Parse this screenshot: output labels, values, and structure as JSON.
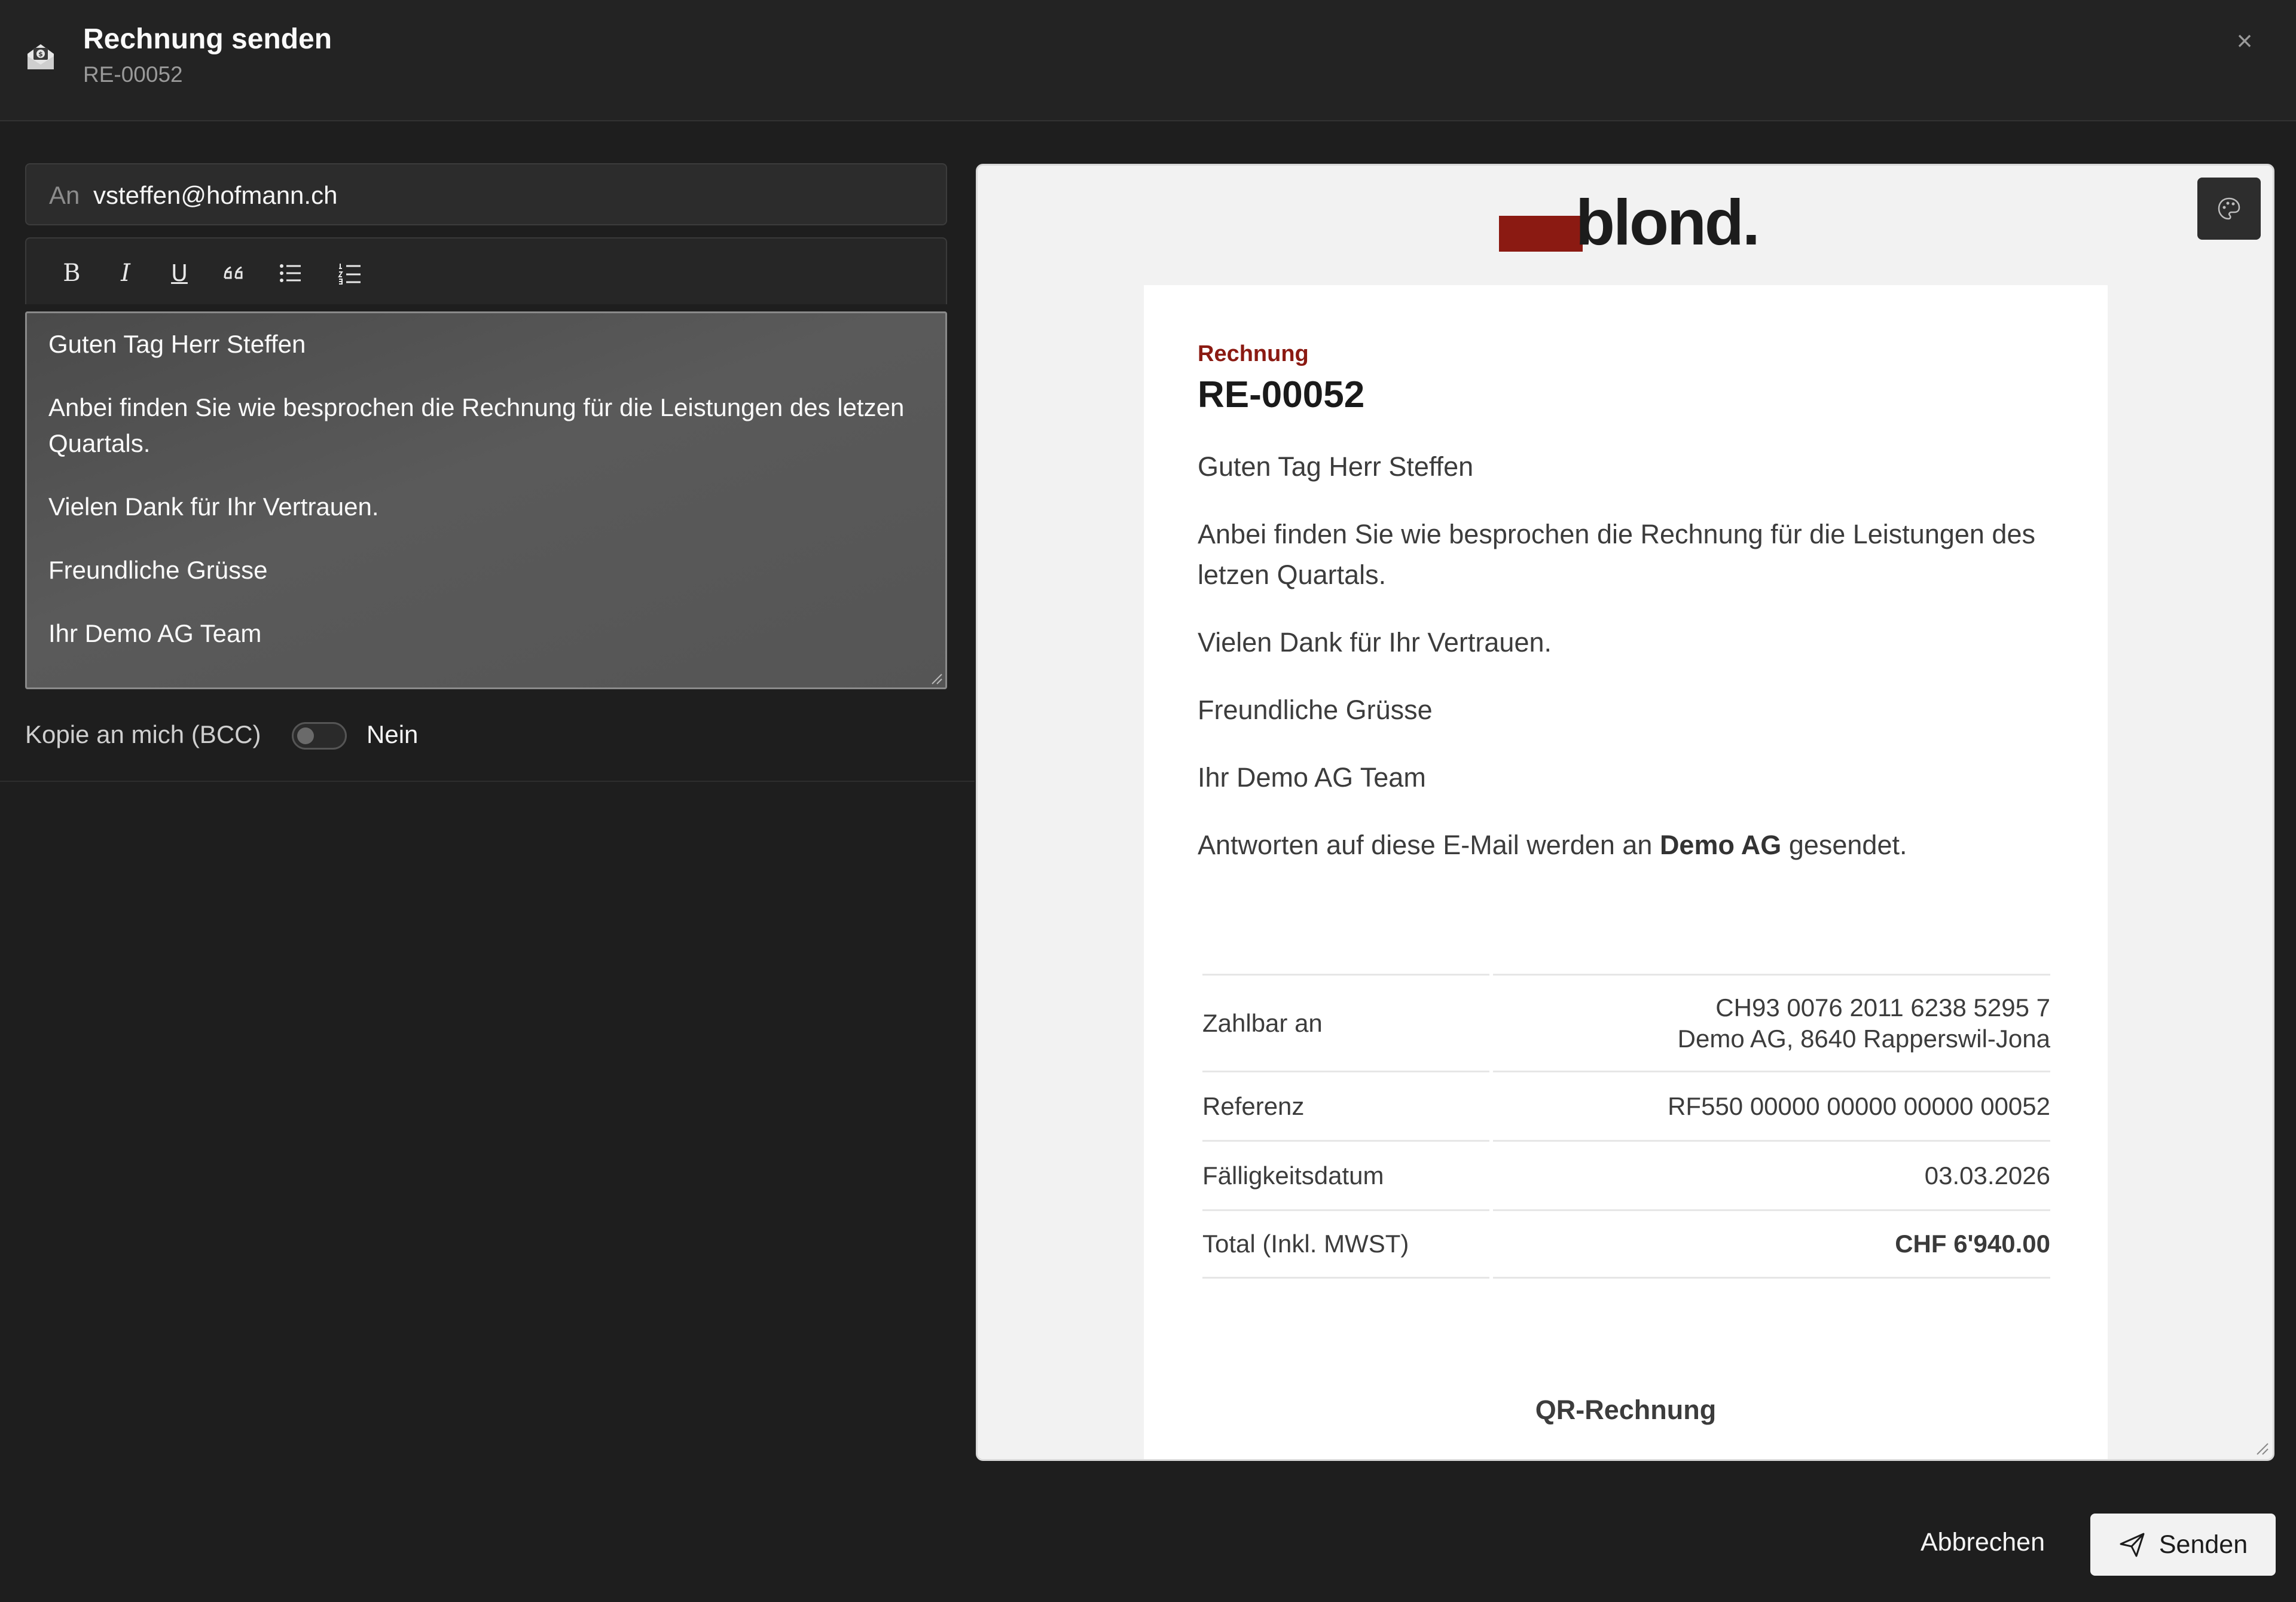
{
  "header": {
    "title": "Rechnung senden",
    "subtitle": "RE-00052",
    "close_glyph": "×",
    "icon": "envelope-money-icon"
  },
  "compose": {
    "to_label": "An",
    "to_value": "vsteffen@hofmann.ch",
    "toolbar": [
      "bold-icon",
      "italic-icon",
      "underline-icon",
      "quote-icon",
      "bullet-list-icon",
      "numbered-list-icon"
    ],
    "toolbar_glyphs": {
      "bold": "B",
      "italic": "I",
      "underline": "U"
    },
    "body": [
      "Guten Tag Herr Steffen",
      "Anbei finden Sie wie besprochen die Rechnung für die Leistungen des letzen Quartals.",
      "Vielen Dank für Ihr Vertrauen.",
      "Freundliche Grüsse",
      "Ihr Demo AG Team"
    ],
    "bcc_label": "Kopie an mich (BCC)",
    "bcc_state": "Nein",
    "bcc_enabled": false
  },
  "preview": {
    "logo_text": "blond.",
    "brand_color": "#8b1a12",
    "kicker": "Rechnung",
    "title": "RE-00052",
    "greeting": "Guten Tag Herr Steffen",
    "paragraph": "Anbei finden Sie wie besprochen die Rechnung für die Leistungen des letzen Quartals.",
    "thanks": "Vielen Dank für Ihr Vertrauen.",
    "closing": "Freundliche Grüsse",
    "signature": "Ihr Demo AG Team",
    "reply_prefix": "Antworten auf diese E-Mail werden an",
    "reply_company": "Demo AG",
    "reply_suffix": "gesendet.",
    "table": {
      "payable_label": "Zahlbar an",
      "payable_iban": "CH93 0076 2011 6238 5295 7",
      "payable_address": "Demo AG, 8640 Rapperswil-Jona",
      "reference_label": "Referenz",
      "reference_value": "RF550 00000 00000 00000 00052",
      "due_label": "Fälligkeitsdatum",
      "due_value": "03.03.2026",
      "total_label": "Total (Inkl. MWST)",
      "total_value": "CHF 6'940.00"
    },
    "qr_heading": "QR-Rechnung",
    "theme_icon": "palette-icon"
  },
  "footer": {
    "cancel_label": "Abbrechen",
    "send_label": "Senden",
    "send_icon": "paper-plane-icon"
  }
}
